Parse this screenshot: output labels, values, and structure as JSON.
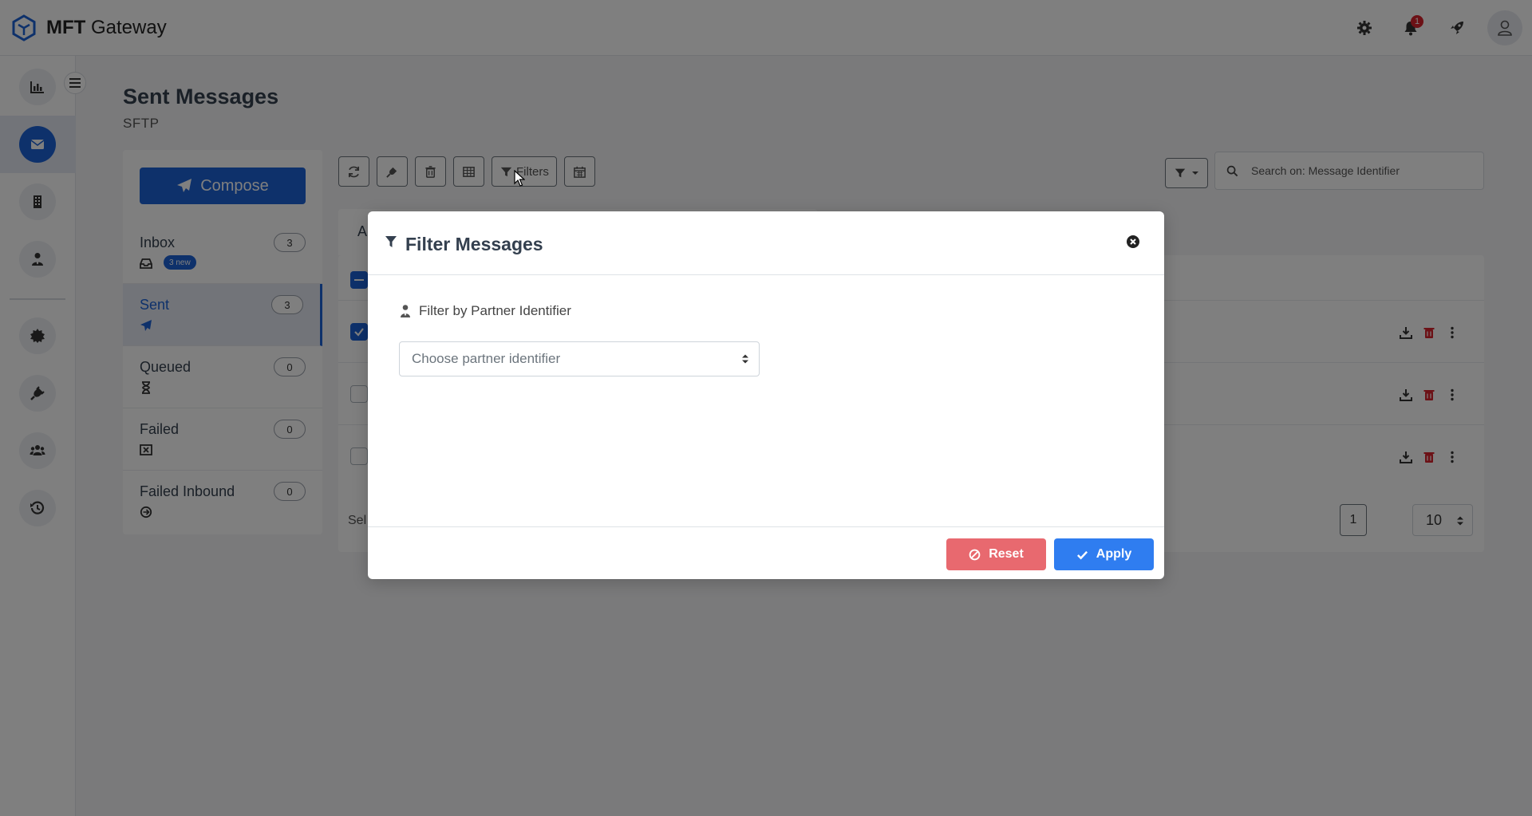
{
  "brand": {
    "name_bold": "MFT",
    "name_rest": " Gateway"
  },
  "header": {
    "notification_count": "1"
  },
  "page": {
    "title": "Sent Messages",
    "subtitle": "SFTP"
  },
  "compose": {
    "label": "Compose"
  },
  "folders": [
    {
      "name": "Inbox",
      "count": "3",
      "badge": "3 new",
      "icon": "inbox-icon"
    },
    {
      "name": "Sent",
      "count": "3",
      "icon": "paper-plane-icon"
    },
    {
      "name": "Queued",
      "count": "0",
      "icon": "hourglass-icon"
    },
    {
      "name": "Failed",
      "count": "0",
      "icon": "failed-box-icon"
    },
    {
      "name": "Failed Inbound",
      "count": "0",
      "icon": "arrow-circle-icon"
    }
  ],
  "toolbar": {
    "filters_label": "Filters"
  },
  "search": {
    "placeholder": "Search on: Message Identifier"
  },
  "list": {
    "tab_label": "A",
    "footer_text": "Sel",
    "page_number": "1",
    "page_size": "10"
  },
  "modal": {
    "title": "Filter Messages",
    "field_label": "Filter by Partner Identifier",
    "select_placeholder": "Choose partner identifier",
    "reset_label": "Reset",
    "apply_label": "Apply"
  },
  "colors": {
    "primary": "#1c62d6",
    "danger": "#e8696f",
    "apply": "#2f7df0"
  }
}
